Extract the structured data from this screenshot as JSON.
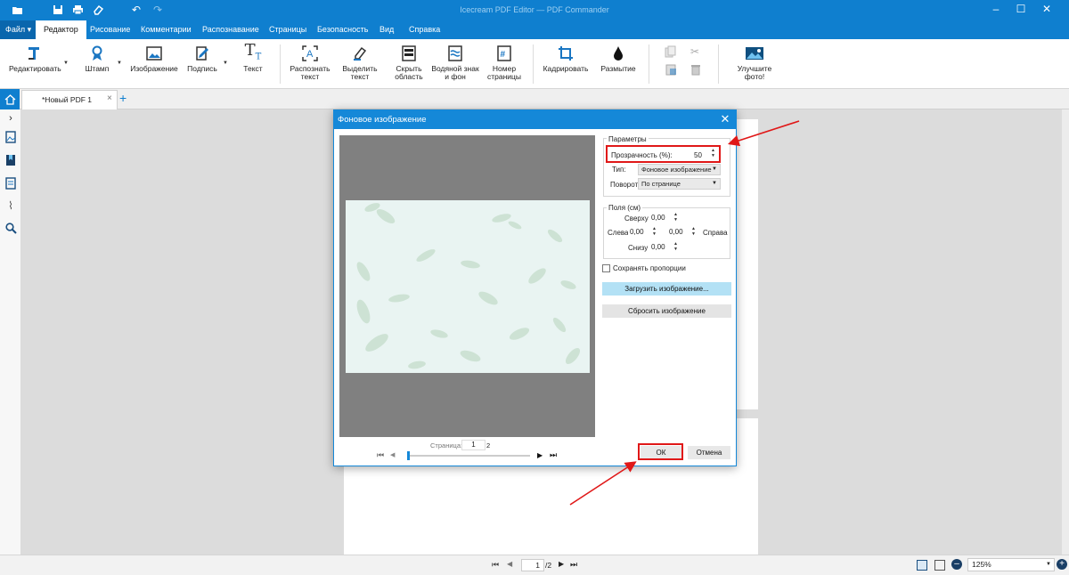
{
  "titlebar": {
    "title": "Icecream PDF Editor — PDF Commander"
  },
  "menu": {
    "file": "Файл",
    "tabs": [
      "Редактор",
      "Рисование",
      "Комментарии",
      "Распознавание",
      "Страницы",
      "Безопасность",
      "Вид",
      "Справка"
    ]
  },
  "ribbon": {
    "edit": "Редактировать",
    "stamp": "Штамп",
    "image": "Изображение",
    "signature": "Подпись",
    "text": "Текст",
    "ocr_1": "Распознать",
    "ocr_2": "текст",
    "select_1": "Выделить",
    "select_2": "текст",
    "hide_1": "Скрыть",
    "hide_2": "область",
    "watermark_1": "Водяной знак",
    "watermark_2": "и фон",
    "pagenum_1": "Номер",
    "pagenum_2": "страницы",
    "crop": "Кадрировать",
    "blur": "Размытие",
    "enhance": "Улучшите фото!"
  },
  "doc_tab": {
    "label": "*Новый PDF 1"
  },
  "dialog": {
    "title": "Фоновое изображение",
    "params_group": "Параметры",
    "opacity_label": "Прозрачность (%):",
    "opacity_value": "50",
    "type_label": "Тип:",
    "type_value": "Фоновое изображение",
    "rotation_label": "Поворот:",
    "rotation_value": "По странице",
    "margins_group": "Поля (см)",
    "top_label": "Сверху",
    "top_value": "0,00",
    "left_label": "Слева",
    "left_value": "0,00",
    "right_value": "0,00",
    "right_label": "Справа",
    "bottom_label": "Снизу",
    "bottom_value": "0,00",
    "keep_ratio": "Сохранять пропорции",
    "load_button": "Загрузить изображение...",
    "reset_button": "Сбросить изображение",
    "page_label": "Страница:",
    "page_current": "1",
    "page_total": "2",
    "page_slider_fraction": 0.0,
    "ok": "ОК",
    "cancel": "Отмена"
  },
  "statusbar": {
    "page_current": "1",
    "page_total": "/2",
    "zoom": "125%"
  },
  "colors": {
    "accent": "#0f7fcf",
    "highlight": "#e01818",
    "load_button": "#b3e1f5"
  }
}
